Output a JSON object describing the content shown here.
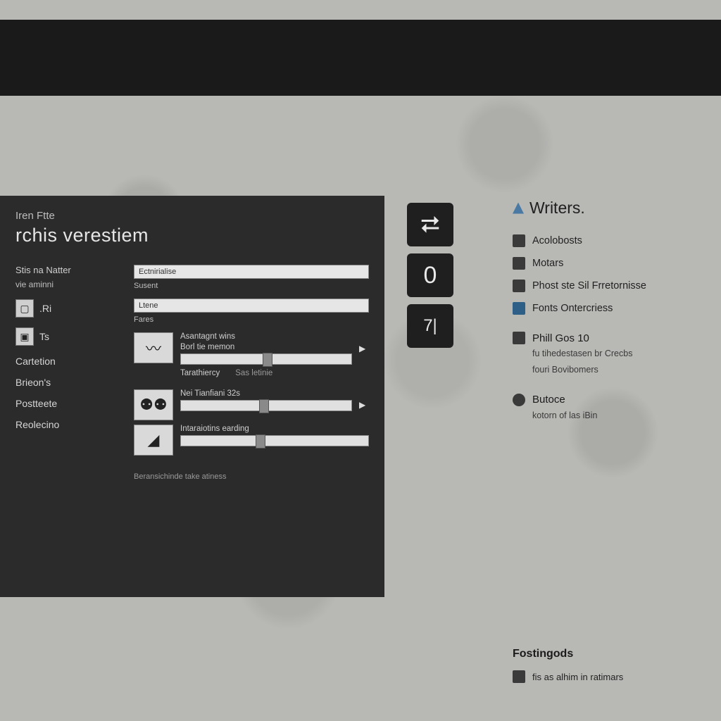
{
  "topbar": {},
  "panel": {
    "subtitle": "Iren Ftte",
    "title": "rchis verestiem",
    "left": {
      "label1": "Stis na Natter",
      "label2": "vie aminni",
      "nav1": {
        "icon": "window-icon",
        "text": ".Ri"
      },
      "nav2": {
        "icon": "devices-icon",
        "text": "Ts"
      },
      "item3": "Cartetion",
      "item4": "Brieon's",
      "item5": "Postteete",
      "item6": "Reolecino"
    },
    "right": {
      "field1_value": "Ectnirialise",
      "field1_caption": "Susent",
      "field2_value": "Ltene",
      "field2_caption": "Fares",
      "row1": {
        "icon": "wave-icon",
        "label": "Asantagnt wins",
        "caption": "Borl tie memon",
        "knob_pct": 48
      },
      "row1b_label": "Tarathiercy",
      "row1b_tag": "Sas letinie",
      "row2": {
        "icon": "people-icon",
        "label": "Nei Tianfiani 32s",
        "knob_pct": 46
      },
      "row3": {
        "icon": "pin-icon",
        "label": "Intaraiotins  earding",
        "knob_pct": 40
      },
      "footnote": "Beransichinde take atiness"
    }
  },
  "iconstack": {
    "i1": "swap-icon",
    "i2": "zero-icon",
    "i3": "seven-one-icon"
  },
  "rightcol": {
    "heading": "Writers.",
    "items": [
      {
        "icon": "doc-icon",
        "label": "Acolobosts"
      },
      {
        "icon": "grid-icon",
        "label": "Motars"
      },
      {
        "icon": "play-icon",
        "label": "Phost ste  Sil Frretornisse"
      },
      {
        "icon": "blue-square-icon",
        "label": "Fonts Ontercriess"
      }
    ],
    "section1": {
      "icon": "page-icon",
      "title": "Phill Gos 10",
      "line1": "fu tihedestasen br Crecbs",
      "line2": "fouri Bovibomers"
    },
    "section2": {
      "icon": "globe-icon",
      "title": "Butoce",
      "line1": "kotorn of las iBin"
    }
  },
  "rfoot": {
    "heading": "Fostingods",
    "item": "fis as alhim in ratimars"
  }
}
